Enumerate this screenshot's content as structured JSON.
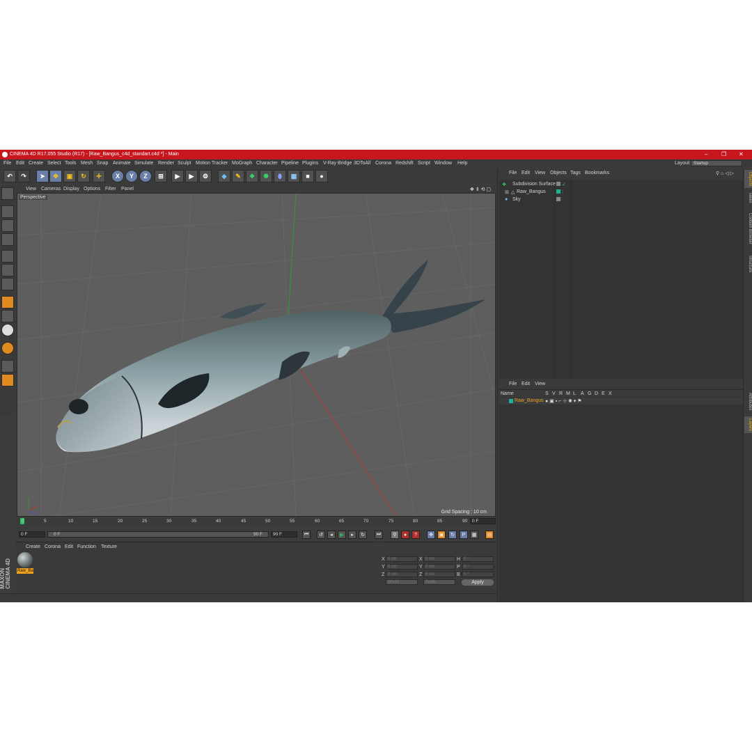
{
  "window": {
    "title": "CINEMA 4D R17.055 Studio (R17) - [Raw_Bangus_c4d_standart.c4d *] - Main"
  },
  "menu": [
    "File",
    "Edit",
    "Create",
    "Select",
    "Tools",
    "Mesh",
    "Snap",
    "Animate",
    "Simulate",
    "Render",
    "Sculpt",
    "Motion Tracker",
    "MoGraph",
    "Character",
    "Pipeline",
    "Plugins",
    "V-Ray Bridge",
    "3DToAll",
    "Corona",
    "Redshift",
    "Script",
    "Window",
    "Help"
  ],
  "layout": {
    "label": "Layout:",
    "value": "Startup"
  },
  "viewport": {
    "menu": [
      "View",
      "Cameras",
      "Display",
      "Options",
      "Filter",
      "Panel"
    ],
    "label": "Perspective",
    "grid_spacing": "Grid Spacing : 10 cm"
  },
  "timeline": {
    "ticks": [
      "0",
      "5",
      "10",
      "15",
      "20",
      "25",
      "30",
      "35",
      "40",
      "45",
      "50",
      "55",
      "60",
      "65",
      "70",
      "75",
      "80",
      "85",
      "90"
    ],
    "end_frame": "0 F",
    "start_field": "0 F",
    "slider_start": "0 F",
    "slider_end": "90 F",
    "max_field": "90 F"
  },
  "material_manager": {
    "menu": [
      "Create",
      "Corona",
      "Edit",
      "Function",
      "Texture"
    ],
    "materials": [
      {
        "name": "Raw_Ba"
      }
    ]
  },
  "coordinates": {
    "rows": [
      {
        "a": "X",
        "av": "0 cm",
        "b": "X",
        "bv": "0 cm",
        "c": "H",
        "cv": "0 °"
      },
      {
        "a": "Y",
        "av": "0 cm",
        "b": "Y",
        "bv": "0 cm",
        "c": "P",
        "cv": "0 °"
      },
      {
        "a": "Z",
        "av": "0 cm",
        "b": "Z",
        "bv": "0 cm",
        "c": "B",
        "cv": "0 °"
      }
    ],
    "mode": "World",
    "scale": "Scale",
    "apply": "Apply"
  },
  "object_manager": {
    "menu": [
      "File",
      "Edit",
      "View",
      "Objects",
      "Tags",
      "Bookmarks"
    ],
    "objects": [
      {
        "name": "Subdivision Surface"
      },
      {
        "name": "Raw_Bangus"
      },
      {
        "name": "Sky"
      }
    ]
  },
  "layer_manager": {
    "menu": [
      "File",
      "Edit",
      "View"
    ],
    "columns": [
      "Name",
      "S",
      "V",
      "R",
      "M",
      "L",
      "A",
      "G",
      "D",
      "E",
      "X"
    ],
    "layers": [
      {
        "name": "Raw_Bangus"
      }
    ]
  },
  "side_tabs": [
    "Objects",
    "Takes",
    "Content Browser",
    "Structure"
  ],
  "side_tabs_lower": [
    "Attributes",
    "Layers"
  ],
  "brand": {
    "line1": "MAXON",
    "line2": "CINEMA 4D"
  },
  "colors": {
    "title_bar": "#c8161e",
    "accent": "#f0a21e",
    "layer_green": "#1ab394"
  }
}
